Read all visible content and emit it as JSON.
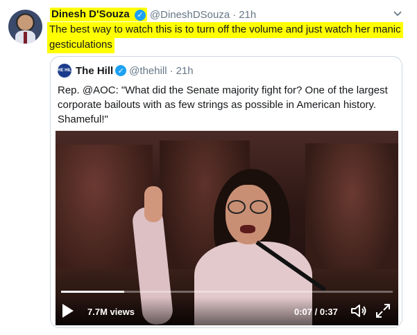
{
  "tweet": {
    "name": "Dinesh D'Souza",
    "handle": "@DineshDSouza",
    "separator": "·",
    "time": "21h",
    "text": "The best way to watch this is to turn off the volume and just watch her manic gesticulations",
    "highlight_color": "#ffff00",
    "icons": {
      "verified": "verified-badge-icon",
      "menu": "chevron-down-icon"
    }
  },
  "quote": {
    "logo_text": "THE HILL",
    "name": "The Hill",
    "handle": "@thehill",
    "separator": "·",
    "time": "21h",
    "text": "Rep. @AOC: \"What did the Senate majority fight for? One of the largest corporate bailouts with as few strings as possible in American history. Shameful!\""
  },
  "video": {
    "views": "7.7M views",
    "time": "0:07 / 0:37",
    "progress": 0.19,
    "icons": {
      "play": "play-icon",
      "volume": "volume-muted-icon",
      "fullscreen": "fullscreen-icon"
    }
  },
  "colors": {
    "accent": "#1da1f2",
    "text": "#14171a",
    "muted": "#657786",
    "border": "#ccd6dd"
  }
}
